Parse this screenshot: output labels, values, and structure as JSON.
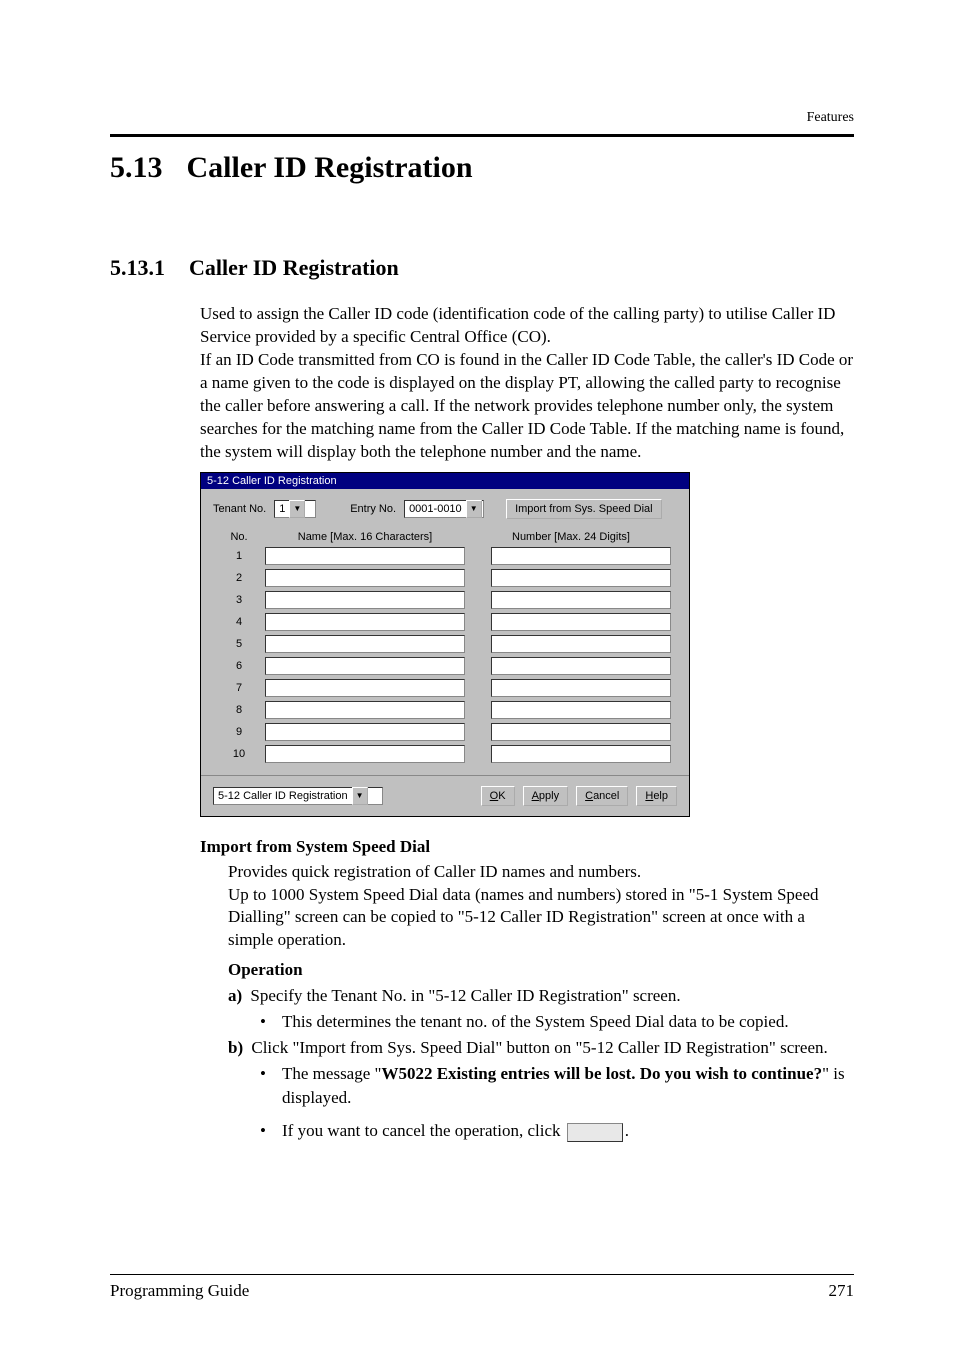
{
  "header": {
    "category": "Features"
  },
  "section": {
    "number": "5.13",
    "title": "Caller ID Registration"
  },
  "subsection": {
    "number": "5.13.1",
    "title": "Caller ID Registration"
  },
  "intro": "Used to assign the Caller ID code (identification code of the calling party) to utilise Caller ID Service provided by a specific Central Office (CO).\nIf an ID Code transmitted from CO is found in the Caller ID Code Table, the caller's ID Code or a name given to the code is displayed on the display PT, allowing the called party to recognise the caller before answering a call. If the network provides telephone number only, the system searches for the matching name from the Caller ID Code Table. If the matching name is found, the system will display both the telephone number and the name.",
  "dialog": {
    "title": "5-12 Caller ID Registration",
    "tenant_label": "Tenant No.",
    "tenant_value": "1",
    "entry_label": "Entry No.",
    "entry_value": "0001-0010",
    "import_btn": "Import from Sys. Speed Dial",
    "col_no": "No.",
    "col_name": "Name [Max. 16 Characters]",
    "col_number": "Number [Max. 24 Digits]",
    "rows": [
      "1",
      "2",
      "3",
      "4",
      "5",
      "6",
      "7",
      "8",
      "9",
      "10"
    ],
    "nav_value": "5-12 Caller ID Registration",
    "ok": "OK",
    "apply": "Apply",
    "cancel": "Cancel",
    "help": "Help"
  },
  "import_section": {
    "heading": "Import from System Speed Dial",
    "p1": "Provides quick registration of Caller ID names and numbers.",
    "p2": "Up to 1000 System Speed Dial data (names and numbers) stored in \"5-1 System Speed Dialling\" screen can be copied to \"5-12 Caller ID Registration\" screen at once with a simple operation.",
    "op_heading": "Operation",
    "steps": {
      "a_label": "a)",
      "a_text": "Specify the Tenant No. in \"5-12 Caller ID Registration\" screen.",
      "a_note": "This determines the tenant no. of the System Speed Dial data to be copied.",
      "b_label": "b)",
      "b_text": "Click \"Import from Sys. Speed Dial\" button on \"5-12 Caller ID Registration\" screen.",
      "b_note1_pre": "The message \"",
      "b_note1_bold": "W5022 Existing entries will be lost. Do you wish to continue?",
      "b_note1_post": "\" is displayed.",
      "b_note2_pre": "If you want to cancel the operation, click ",
      "b_note2_post": "."
    }
  },
  "footer": {
    "left": "Programming Guide",
    "right": "271"
  }
}
